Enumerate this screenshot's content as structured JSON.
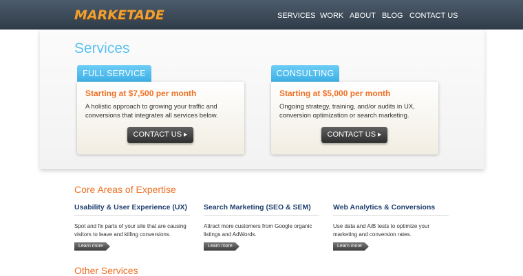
{
  "header": {
    "logo_text": "MARKETADE",
    "nav": [
      "SERVICES",
      "WORK",
      "ABOUT",
      "BLOG",
      "CONTACT US"
    ]
  },
  "services": {
    "title": "Services",
    "cards": [
      {
        "tab": "FULL SERVICE",
        "price": "Starting at $7,500 per month",
        "desc": "A holistic approach to growing your traffic and conversions that integrates all services below.",
        "button": "CONTACT US"
      },
      {
        "tab": "CONSULTING",
        "price": "Starting at $5,000 per month",
        "desc": "Ongoing strategy, training, and/or audits in UX, conversion optimization or search marketing.",
        "button": "CONTACT US"
      }
    ]
  },
  "expertise": {
    "title": "Core Areas of Expertise",
    "columns": [
      {
        "title": "Usability & User Experience (UX)",
        "text": "Spot and fix parts of your site that are causing visitors to leave and killing conversions.",
        "link": "Learn more"
      },
      {
        "title": "Search Marketing (SEO & SEM)",
        "text": "Attract more customers from Google organic listings and AdWords.",
        "link": "Learn more"
      },
      {
        "title": "Web Analytics & Conversions",
        "text": "Use data and A/B tests to optimize your marketing and conversion rates.",
        "link": "Learn more"
      }
    ]
  },
  "other": {
    "title": "Other Services"
  },
  "colors": {
    "accent_blue": "#5cc2f0",
    "accent_orange": "#ee7024",
    "header_bg": "#3a4756",
    "heading_navy": "#1e3f6e"
  }
}
